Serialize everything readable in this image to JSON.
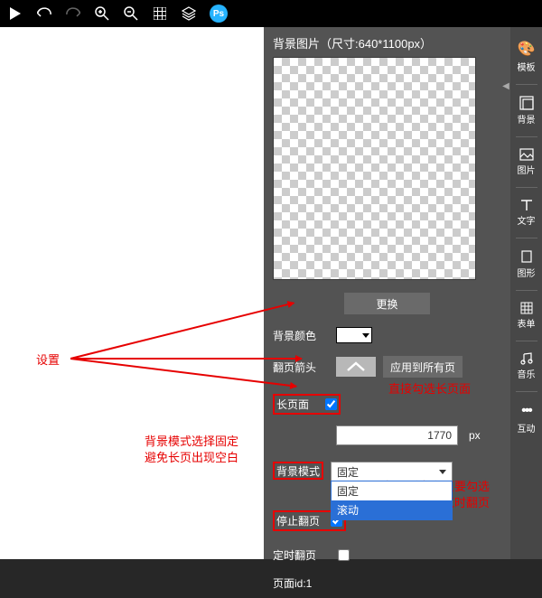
{
  "toolbar": {
    "ps_badge": "Ps"
  },
  "panel": {
    "bg_title": "背景图片（尺寸:640*1100px）",
    "replace_btn": "更换",
    "bg_color_label": "背景颜色",
    "flip_arrow_label": "翻页箭头",
    "apply_all_btn": "应用到所有页",
    "long_page_label": "长页面",
    "long_page_checked": true,
    "long_page_value": "1770",
    "px_unit": "px",
    "bg_mode_label": "背景模式",
    "bg_mode_selected": "固定",
    "bg_mode_options": [
      "固定",
      "滚动"
    ],
    "stop_flip_label": "停止翻页",
    "stop_flip_checked": true,
    "timed_flip_label": "定时翻页",
    "timed_flip_checked": false,
    "page_id_label": "页面id:1"
  },
  "sidebar": {
    "template": "模板",
    "background": "背景",
    "image": "图片",
    "text": "文字",
    "shape": "图形",
    "form": "表单",
    "music": "音乐",
    "interact": "互动"
  },
  "annotations": {
    "settings": "设置",
    "direct_check": "直接勾选长页面",
    "bg_mode_note1": "背景模式选择固定",
    "bg_mode_note2": "避免长页出现空白",
    "stop_flip_note1": "长页后有翻页要勾选",
    "stop_flip_note2": "避免长页浏览时翻页"
  }
}
